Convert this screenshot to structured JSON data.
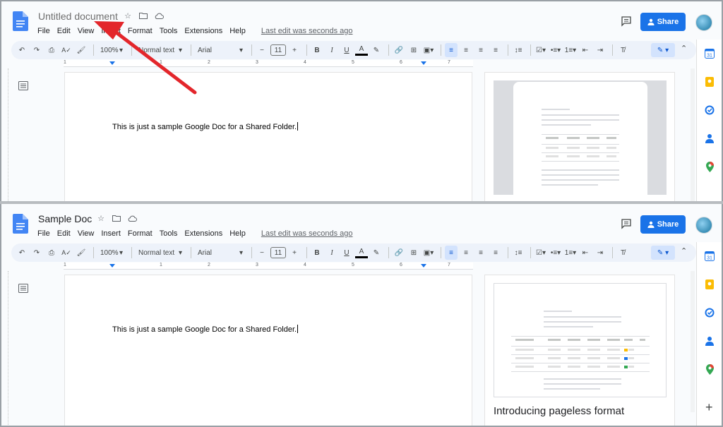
{
  "panels": [
    {
      "doc_title": "Untitled document",
      "menu": [
        "File",
        "Edit",
        "View",
        "Insert",
        "Format",
        "Tools",
        "Extensions",
        "Help"
      ],
      "last_edit": "Last edit was seconds ago",
      "share_label": "Share",
      "toolbar": {
        "zoom": "100%",
        "style": "Normal text",
        "font": "Arial",
        "size": "11"
      },
      "body_text": "This is just a sample Google Doc for a Shared Folder.",
      "popup_title": ""
    },
    {
      "doc_title": "Sample Doc",
      "menu": [
        "File",
        "Edit",
        "View",
        "Insert",
        "Format",
        "Tools",
        "Extensions",
        "Help"
      ],
      "last_edit": "Last edit was seconds ago",
      "share_label": "Share",
      "toolbar": {
        "zoom": "100%",
        "style": "Normal text",
        "font": "Arial",
        "size": "11"
      },
      "body_text": "This is just a sample Google Doc for a Shared Folder.",
      "popup_title": "Introducing pageless format"
    }
  ],
  "ruler_numbers": [
    "1",
    "1",
    "2",
    "3",
    "4",
    "5",
    "6",
    "7"
  ],
  "colors": {
    "accent": "#1a73e8",
    "arrow": "#e3262b",
    "toolbar_bg": "#edf2fa"
  }
}
